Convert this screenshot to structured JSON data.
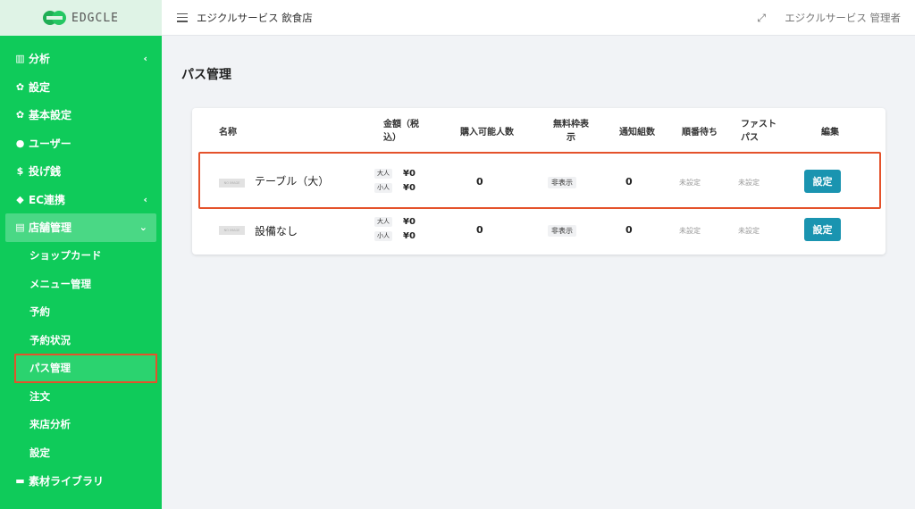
{
  "sidebar": {
    "logo_text": "EDGCLE",
    "items": [
      {
        "icon": "bar-chart-icon",
        "glyph": "▥",
        "label": "分析",
        "has_chevron": true
      },
      {
        "icon": "gear-icon",
        "glyph": "✿",
        "label": "設定"
      },
      {
        "icon": "gear-icon",
        "glyph": "✿",
        "label": "基本設定"
      },
      {
        "icon": "user-icon",
        "glyph": "●",
        "label": "ユーザー"
      },
      {
        "icon": "dollar-icon",
        "glyph": "$",
        "label": "投げ銭"
      },
      {
        "icon": "bag-icon",
        "glyph": "◆",
        "label": "EC連携",
        "has_chevron": true
      },
      {
        "icon": "store-icon",
        "glyph": "▤",
        "label": "店舗管理",
        "open": true
      }
    ],
    "sub_items": [
      "ショップカード",
      "メニュー管理",
      "予約",
      "予約状況",
      "パス管理",
      "注文",
      "来店分析",
      "設定"
    ],
    "last_item": {
      "icon": "folder-icon",
      "glyph": "▬",
      "label": "素材ライブラリ"
    }
  },
  "topbar": {
    "store_name": "エジクルサービス 飲食店",
    "user_name": "エジクルサービス 管理者"
  },
  "page": {
    "title": "パス管理"
  },
  "table": {
    "headers": {
      "name": "名称",
      "price_l1": "金額（税",
      "price_l2": "込）",
      "capacity": "購入可能人数",
      "free_l1": "無料枠表",
      "free_l2": "示",
      "notify": "通知組数",
      "queue": "順番待ち",
      "fast_l1": "ファスト",
      "fast_l2": "パス",
      "edit": "編集"
    },
    "thumb_text": "NO IMAGE",
    "rows": [
      {
        "name": "テーブル（大）",
        "adult_label": "大人",
        "adult_price": "¥0",
        "child_label": "小人",
        "child_price": "¥0",
        "capacity": "0",
        "free_display": "非表示",
        "notify": "0",
        "queue": "未設定",
        "fastpass": "未設定",
        "button": "設定"
      },
      {
        "name": "設備なし",
        "adult_label": "大人",
        "adult_price": "¥0",
        "child_label": "小人",
        "child_price": "¥0",
        "capacity": "0",
        "free_display": "非表示",
        "notify": "0",
        "queue": "未設定",
        "fastpass": "未設定",
        "button": "設定"
      }
    ]
  },
  "colors": {
    "sidebar_bg": "#0fcb5a",
    "button_bg": "#1a94b0",
    "highlight": "#e4522b"
  }
}
